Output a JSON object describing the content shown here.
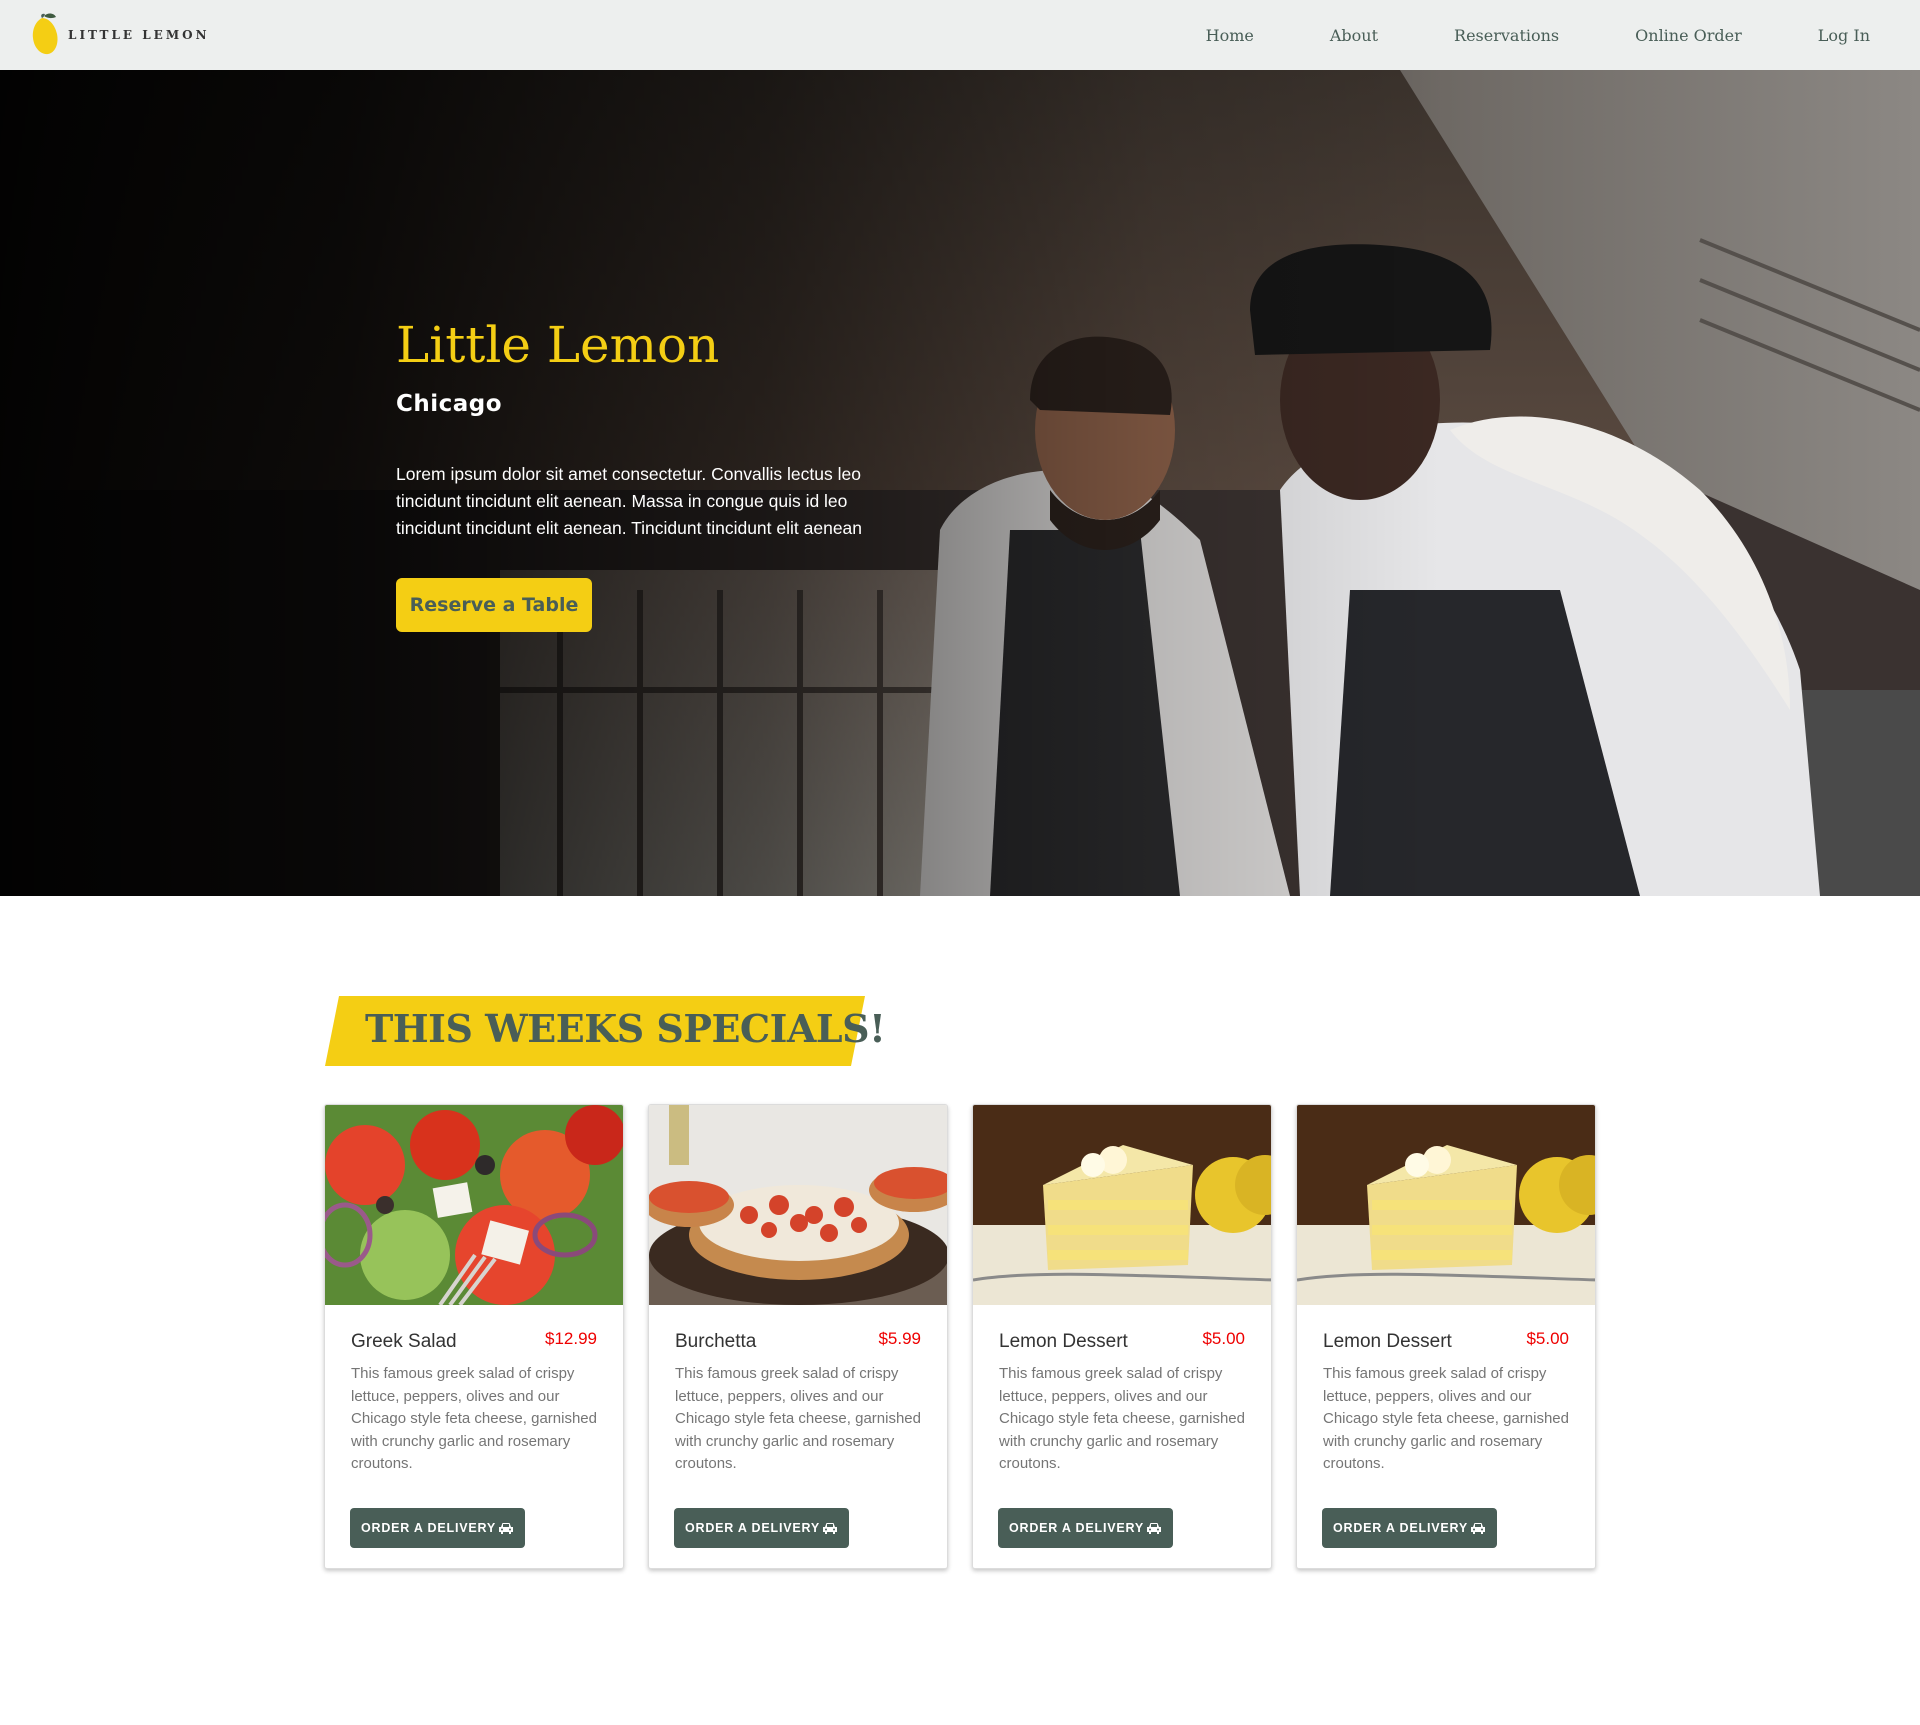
{
  "brand": {
    "logo_text": "LITTLE LEMON",
    "accent": "#f4ce14",
    "primary": "#495e57",
    "price_color": "#ee0000"
  },
  "nav": {
    "links": [
      {
        "label": "Home"
      },
      {
        "label": "About"
      },
      {
        "label": "Reservations"
      },
      {
        "label": "Online Order"
      },
      {
        "label": "Log In"
      }
    ]
  },
  "hero": {
    "title": "Little Lemon",
    "subtitle": "Chicago",
    "description": "Lorem ipsum dolor sit amet consectetur. Convallis lectus leo tincidunt tincidunt elit aenean. Massa in congue quis id leo tincidunt tincidunt elit aenean. Tincidunt tincidunt elit aenean",
    "cta_label": "Reserve a Table"
  },
  "specials": {
    "heading": "THIS WEEKS SPECIALS!",
    "cards": [
      {
        "name": "Greek Salad",
        "price": "$12.99",
        "description": "This famous greek salad of crispy lettuce, peppers, olives and our Chicago style feta cheese, garnished with crunchy garlic and rosemary croutons.",
        "button": "ORDER A DELIVERY",
        "icon": "car-icon"
      },
      {
        "name": "Burchetta",
        "price": "$5.99",
        "description": "This famous greek salad of crispy lettuce, peppers, olives and our Chicago style feta cheese, garnished with crunchy garlic and rosemary croutons.",
        "button": "ORDER A DELIVERY",
        "icon": "car-icon"
      },
      {
        "name": "Lemon Dessert",
        "price": "$5.00",
        "description": "This famous greek salad of crispy lettuce, peppers, olives and our Chicago style feta cheese, garnished with crunchy garlic and rosemary croutons.",
        "button": "ORDER A DELIVERY",
        "icon": "car-icon"
      },
      {
        "name": "Lemon Dessert",
        "price": "$5.00",
        "description": "This famous greek salad of crispy lettuce, peppers, olives and our Chicago style feta cheese, garnished with crunchy garlic and rosemary croutons.",
        "button": "ORDER A DELIVERY",
        "icon": "car-icon"
      }
    ]
  }
}
